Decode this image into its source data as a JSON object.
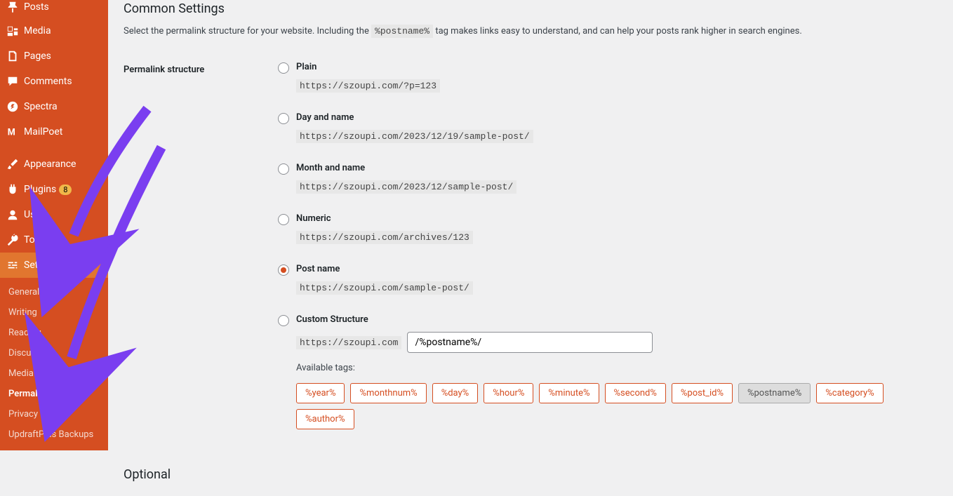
{
  "sidebar": {
    "items": [
      {
        "label": "Posts",
        "icon": "pin"
      },
      {
        "label": "Media",
        "icon": "media"
      },
      {
        "label": "Pages",
        "icon": "page"
      },
      {
        "label": "Comments",
        "icon": "comment"
      },
      {
        "label": "Spectra",
        "icon": "spectra"
      },
      {
        "label": "MailPoet",
        "icon": "mailpoet"
      },
      {
        "label": "Appearance",
        "icon": "brush"
      },
      {
        "label": "Plugins",
        "icon": "plug",
        "badge": "8"
      },
      {
        "label": "Users",
        "icon": "user"
      },
      {
        "label": "Tools",
        "icon": "wrench"
      },
      {
        "label": "Settings",
        "icon": "sliders",
        "active": true
      }
    ],
    "submenu": [
      "General",
      "Writing",
      "Reading",
      "Discussion",
      "Media",
      "Permalinks",
      "Privacy",
      "UpdraftPlus Backups"
    ],
    "submenu_current": "Permalinks"
  },
  "content": {
    "heading": "Common Settings",
    "desc_before": "Select the permalink structure for your website. Including the ",
    "desc_tag": "%postname%",
    "desc_after": " tag makes links easy to understand, and can help your posts rank higher in search engines.",
    "form_label": "Permalink structure",
    "options": [
      {
        "title": "Plain",
        "example": "https://szoupi.com/?p=123",
        "selected": false
      },
      {
        "title": "Day and name",
        "example": "https://szoupi.com/2023/12/19/sample-post/",
        "selected": false
      },
      {
        "title": "Month and name",
        "example": "https://szoupi.com/2023/12/sample-post/",
        "selected": false
      },
      {
        "title": "Numeric",
        "example": "https://szoupi.com/archives/123",
        "selected": false
      },
      {
        "title": "Post name",
        "example": "https://szoupi.com/sample-post/",
        "selected": true
      },
      {
        "title": "Custom Structure",
        "selected": false,
        "custom": true
      }
    ],
    "custom_prefix": "https://szoupi.com",
    "custom_value": "/%postname%/",
    "available_label": "Available tags:",
    "tags": [
      "%year%",
      "%monthnum%",
      "%day%",
      "%hour%",
      "%minute%",
      "%second%",
      "%post_id%",
      "%postname%",
      "%category%",
      "%author%"
    ],
    "tag_used": "%postname%",
    "optional_heading": "Optional"
  }
}
